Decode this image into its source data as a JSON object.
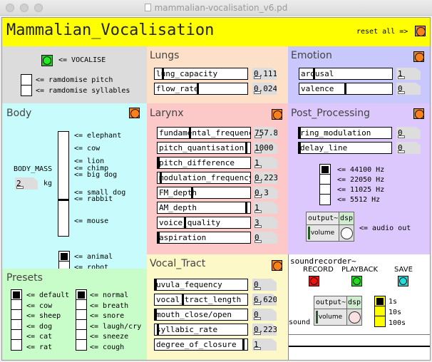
{
  "window": {
    "title": "mammalian-vocalisation_v6.pd"
  },
  "header": {
    "title": "Mammalian_Vocalisation",
    "reset_label": "reset all =>",
    "background": "#ffff00"
  },
  "control": {
    "vocalise_label": "<= VOCALISE",
    "vocalise_color": "#22cc22",
    "randomise_pitch_label": "<= ramdomise pitch",
    "randomise_syllables_label": "<= ramdomise syllables",
    "randomise_pitch_on": false,
    "randomise_syllables_on": false
  },
  "lungs": {
    "title": "Lungs",
    "sliders": [
      {
        "label": "lung_capacity",
        "value": "0.111",
        "fraction": 0.08
      },
      {
        "label": "flow_rate",
        "value": "0.024",
        "fraction": 0.47
      }
    ]
  },
  "emotion": {
    "title": "Emotion",
    "sliders": [
      {
        "label": "arousal",
        "value": "1",
        "fraction": 0.15
      },
      {
        "label": "valence",
        "value": "0",
        "fraction": 0.5
      }
    ]
  },
  "body": {
    "title": "Body",
    "mass_label": "BODY_MASS",
    "mass_value": "2",
    "mass_unit": "kg",
    "animals": [
      "<= elephant",
      "<= cow",
      "<= lion",
      "<= chimp",
      "<= big dog",
      "<= small dog",
      "<= rabbit",
      "<= mouse"
    ],
    "slider_fraction": 0.35,
    "type_options": [
      "<= animal",
      "<= robot"
    ],
    "type_selected": 0
  },
  "larynx": {
    "title": "Larynx",
    "sliders": [
      {
        "label": "fundamental_frequency",
        "value": "757.8",
        "fraction": 0.35
      },
      {
        "label": "pitch_quantisation",
        "value": "1000",
        "fraction": 0.98
      },
      {
        "label": "pitch_difference",
        "value": "1",
        "fraction": 0.0
      },
      {
        "label": "modulation_frequency",
        "value": "0.223",
        "fraction": 0.02
      },
      {
        "label": "FM_depth",
        "value": "0.3",
        "fraction": 0.37
      },
      {
        "label": "AM_depth",
        "value": "1",
        "fraction": 0.98
      },
      {
        "label": "voice_quality",
        "value": "3",
        "fraction": 0.29
      },
      {
        "label": "aspiration",
        "value": "0",
        "fraction": 0.0
      }
    ]
  },
  "post_processing": {
    "title": "Post_Processing",
    "sliders": [
      {
        "label": "ring_modulation",
        "value": "0",
        "fraction": 0.0
      },
      {
        "label": "delay_line",
        "value": "0",
        "fraction": 0.0
      }
    ],
    "sample_rates": [
      "<= 44100 Hz",
      "<= 22050 Hz",
      "<= 11025 Hz",
      "<= 5512 Hz"
    ],
    "sample_rate_selected": 0,
    "output": {
      "name": "output~",
      "volume": "volume",
      "dsp": "dsp",
      "label": "<= audio out"
    }
  },
  "presets": {
    "title": "Presets",
    "animals": [
      "<= default",
      "<= cow",
      "<= sheep",
      "<= dog",
      "<= cat",
      "<= rat"
    ],
    "animal_selected": 0,
    "modes": [
      "<= normal",
      "<= breath",
      "<= snore",
      "<= laugh/cry",
      "<= sneeze",
      "<= cough"
    ],
    "mode_selected": 0
  },
  "vocal_tract": {
    "title": "Vocal_Tract",
    "sliders": [
      {
        "label": "uvula_fequency",
        "value": "0",
        "fraction": 0.0
      },
      {
        "label": "vocal_tract_length",
        "value": "6.620",
        "fraction": 0.3
      },
      {
        "label": "mouth_close/open",
        "value": "0",
        "fraction": 0.0
      },
      {
        "label": "syllabic_rate",
        "value": "0.223",
        "fraction": 0.02
      },
      {
        "label": "degree_of_closure",
        "value": "1",
        "fraction": 0.98
      }
    ]
  },
  "recorder": {
    "title": "soundrecorder~",
    "record_label": "RECORD",
    "playback_label": "PLAYBACK",
    "save_label": "SAVE",
    "record_color": "#ee1111",
    "playback_color": "#22dd22",
    "save_color": "#22dddd",
    "durations": [
      "1s",
      "10s",
      "100s"
    ],
    "duration_selected": 0,
    "sound_label": "sound",
    "output": {
      "name": "output~",
      "volume": "volume",
      "dsp": "dsp"
    }
  }
}
